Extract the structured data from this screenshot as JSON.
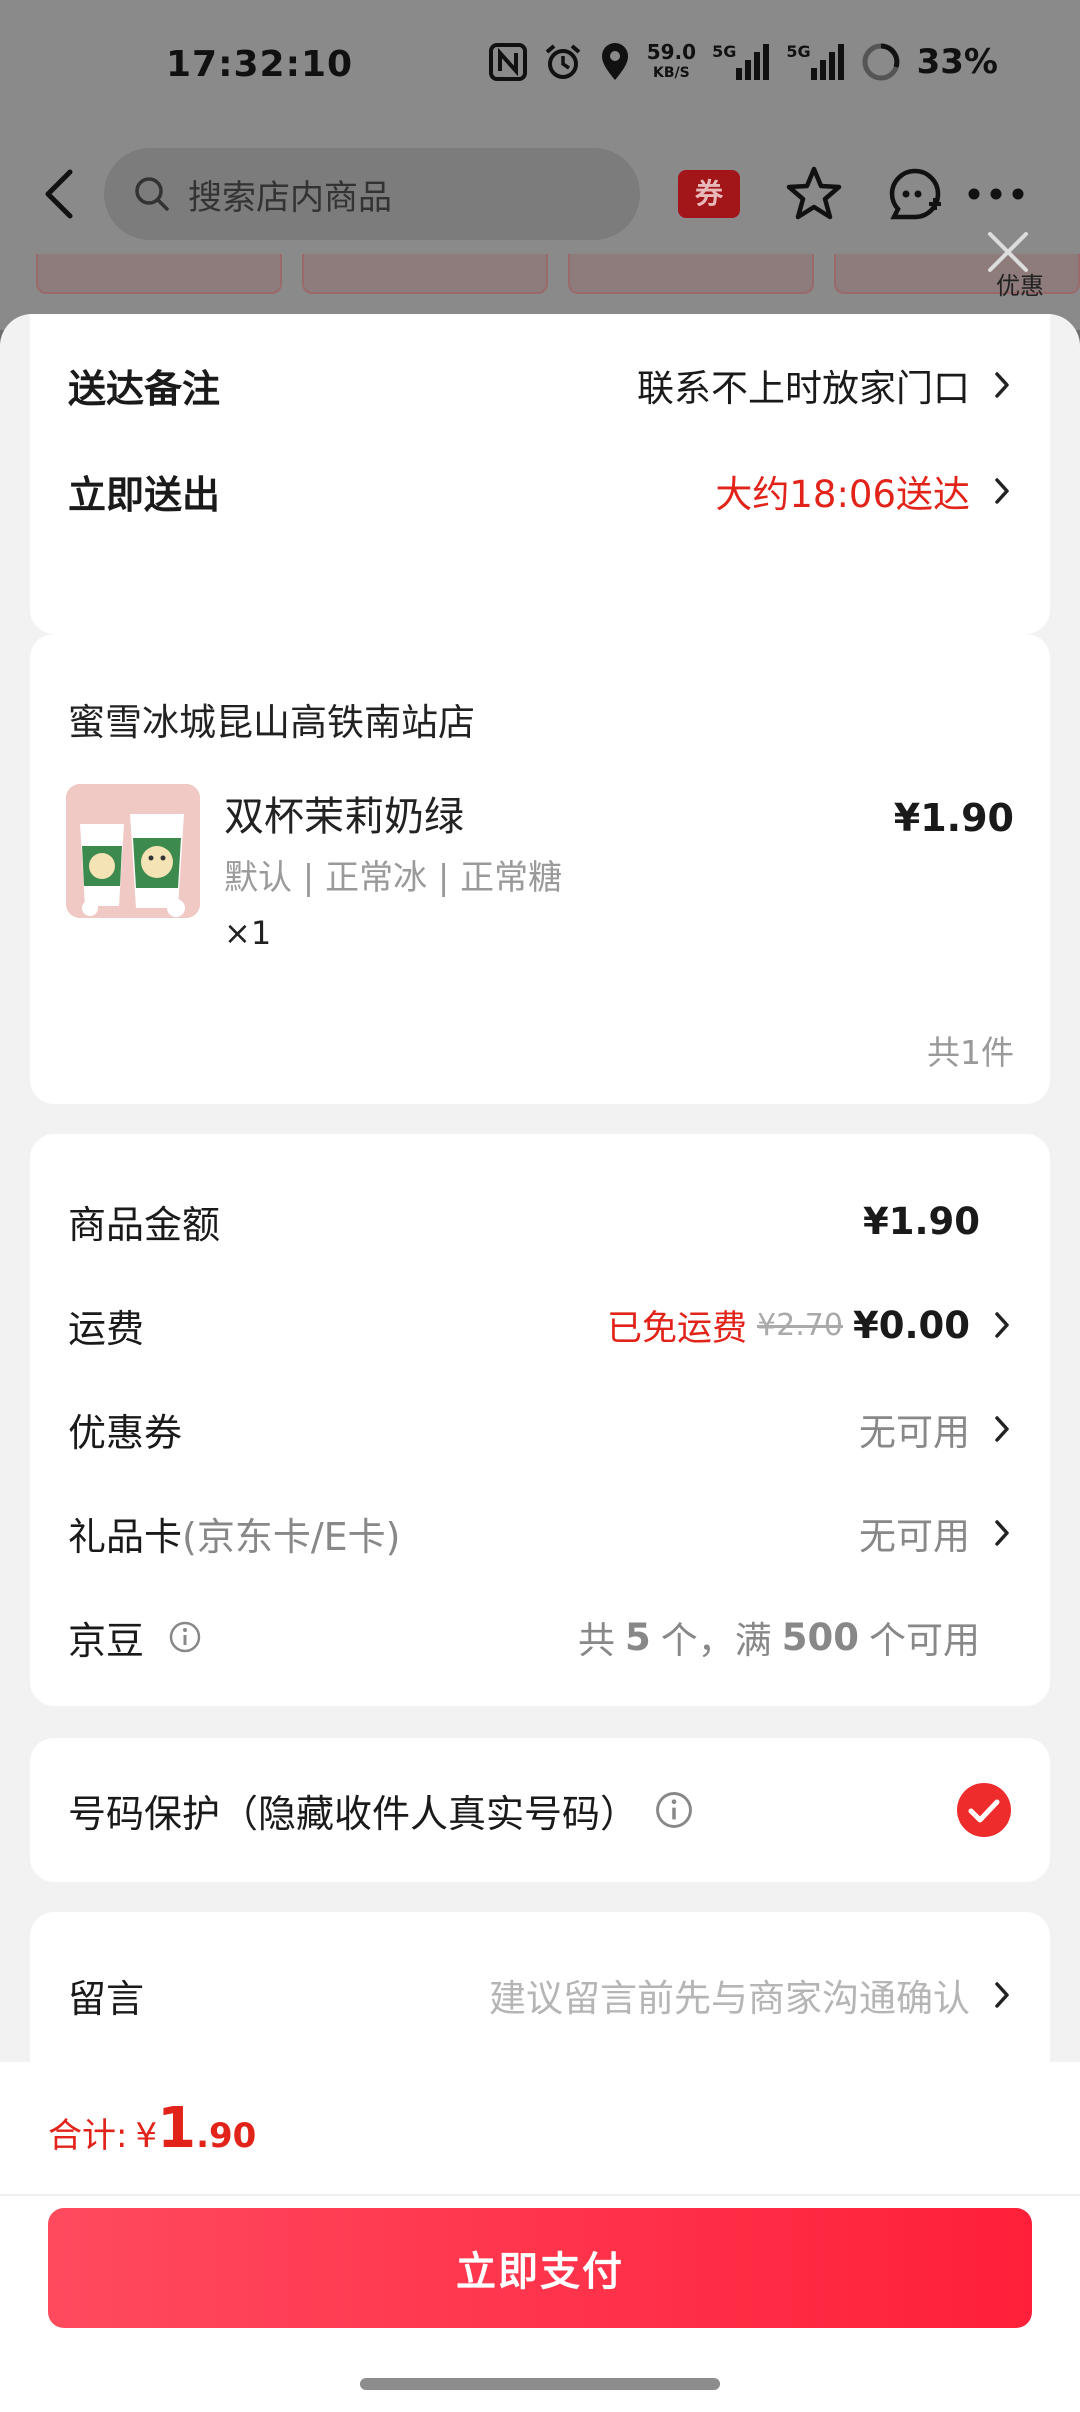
{
  "status_bar": {
    "time": "17:32:10",
    "net_speed_value": "59.0",
    "net_speed_unit": "KB/S",
    "sig1_label": "5G",
    "sig2_label": "5G",
    "battery": "33%"
  },
  "nav": {
    "search_placeholder": "搜索店内商品",
    "coupon_badge": "券",
    "close_caption": "优惠"
  },
  "delivery": {
    "note_label": "送达备注",
    "note_value": "联系不上时放家门口",
    "dispatch_label": "立即送出",
    "dispatch_value": "大约18:06送达"
  },
  "order": {
    "store_name": "蜜雪冰城昆山高铁南站店",
    "product_name": "双杯茉莉奶绿",
    "product_spec": "默认 | 正常冰 | 正常糖",
    "product_qty": "×1",
    "product_price": "¥1.90",
    "item_count": "共1件"
  },
  "fees": {
    "goods_label": "商品金额",
    "goods_value": "¥1.90",
    "shipping_label": "运费",
    "shipping_free_tag": "已免运费",
    "shipping_original": "¥2.70",
    "shipping_value": "¥0.00",
    "coupon_label": "优惠券",
    "coupon_value": "无可用",
    "giftcard_label": "礼品卡",
    "giftcard_sub": "(京东卡/E卡)",
    "giftcard_value": "无可用",
    "jd_bean_label": "京豆",
    "jd_bean_value_prefix": "共",
    "jd_bean_count": "5",
    "jd_bean_value_mid": "个，满",
    "jd_bean_threshold": "500",
    "jd_bean_value_suffix": "个可用"
  },
  "privacy": {
    "label": "号码保护（隐藏收件人真实号码）",
    "checked": true
  },
  "message": {
    "label": "留言",
    "placeholder": "建议留言前先与商家沟通确认"
  },
  "footer": {
    "total_label": "合计:",
    "total_currency": "¥",
    "total_int": "1",
    "total_dec": ".90",
    "pay_button": "立即支付"
  },
  "colors": {
    "accent_red": "#e2231a",
    "pay_gradient_start": "#ff4a5e",
    "pay_gradient_end": "#ff1f3a",
    "overlay": "#8a8a8a",
    "sheet_bg": "#f2f2f2"
  },
  "icons": [
    "back-arrow-icon",
    "search-icon",
    "star-icon",
    "customer-service-icon",
    "more-icon",
    "close-icon",
    "chevron-right-icon",
    "info-icon",
    "checkmark-icon",
    "nfc-icon",
    "alarm-icon",
    "location-icon",
    "signal-icon",
    "battery-icon"
  ]
}
